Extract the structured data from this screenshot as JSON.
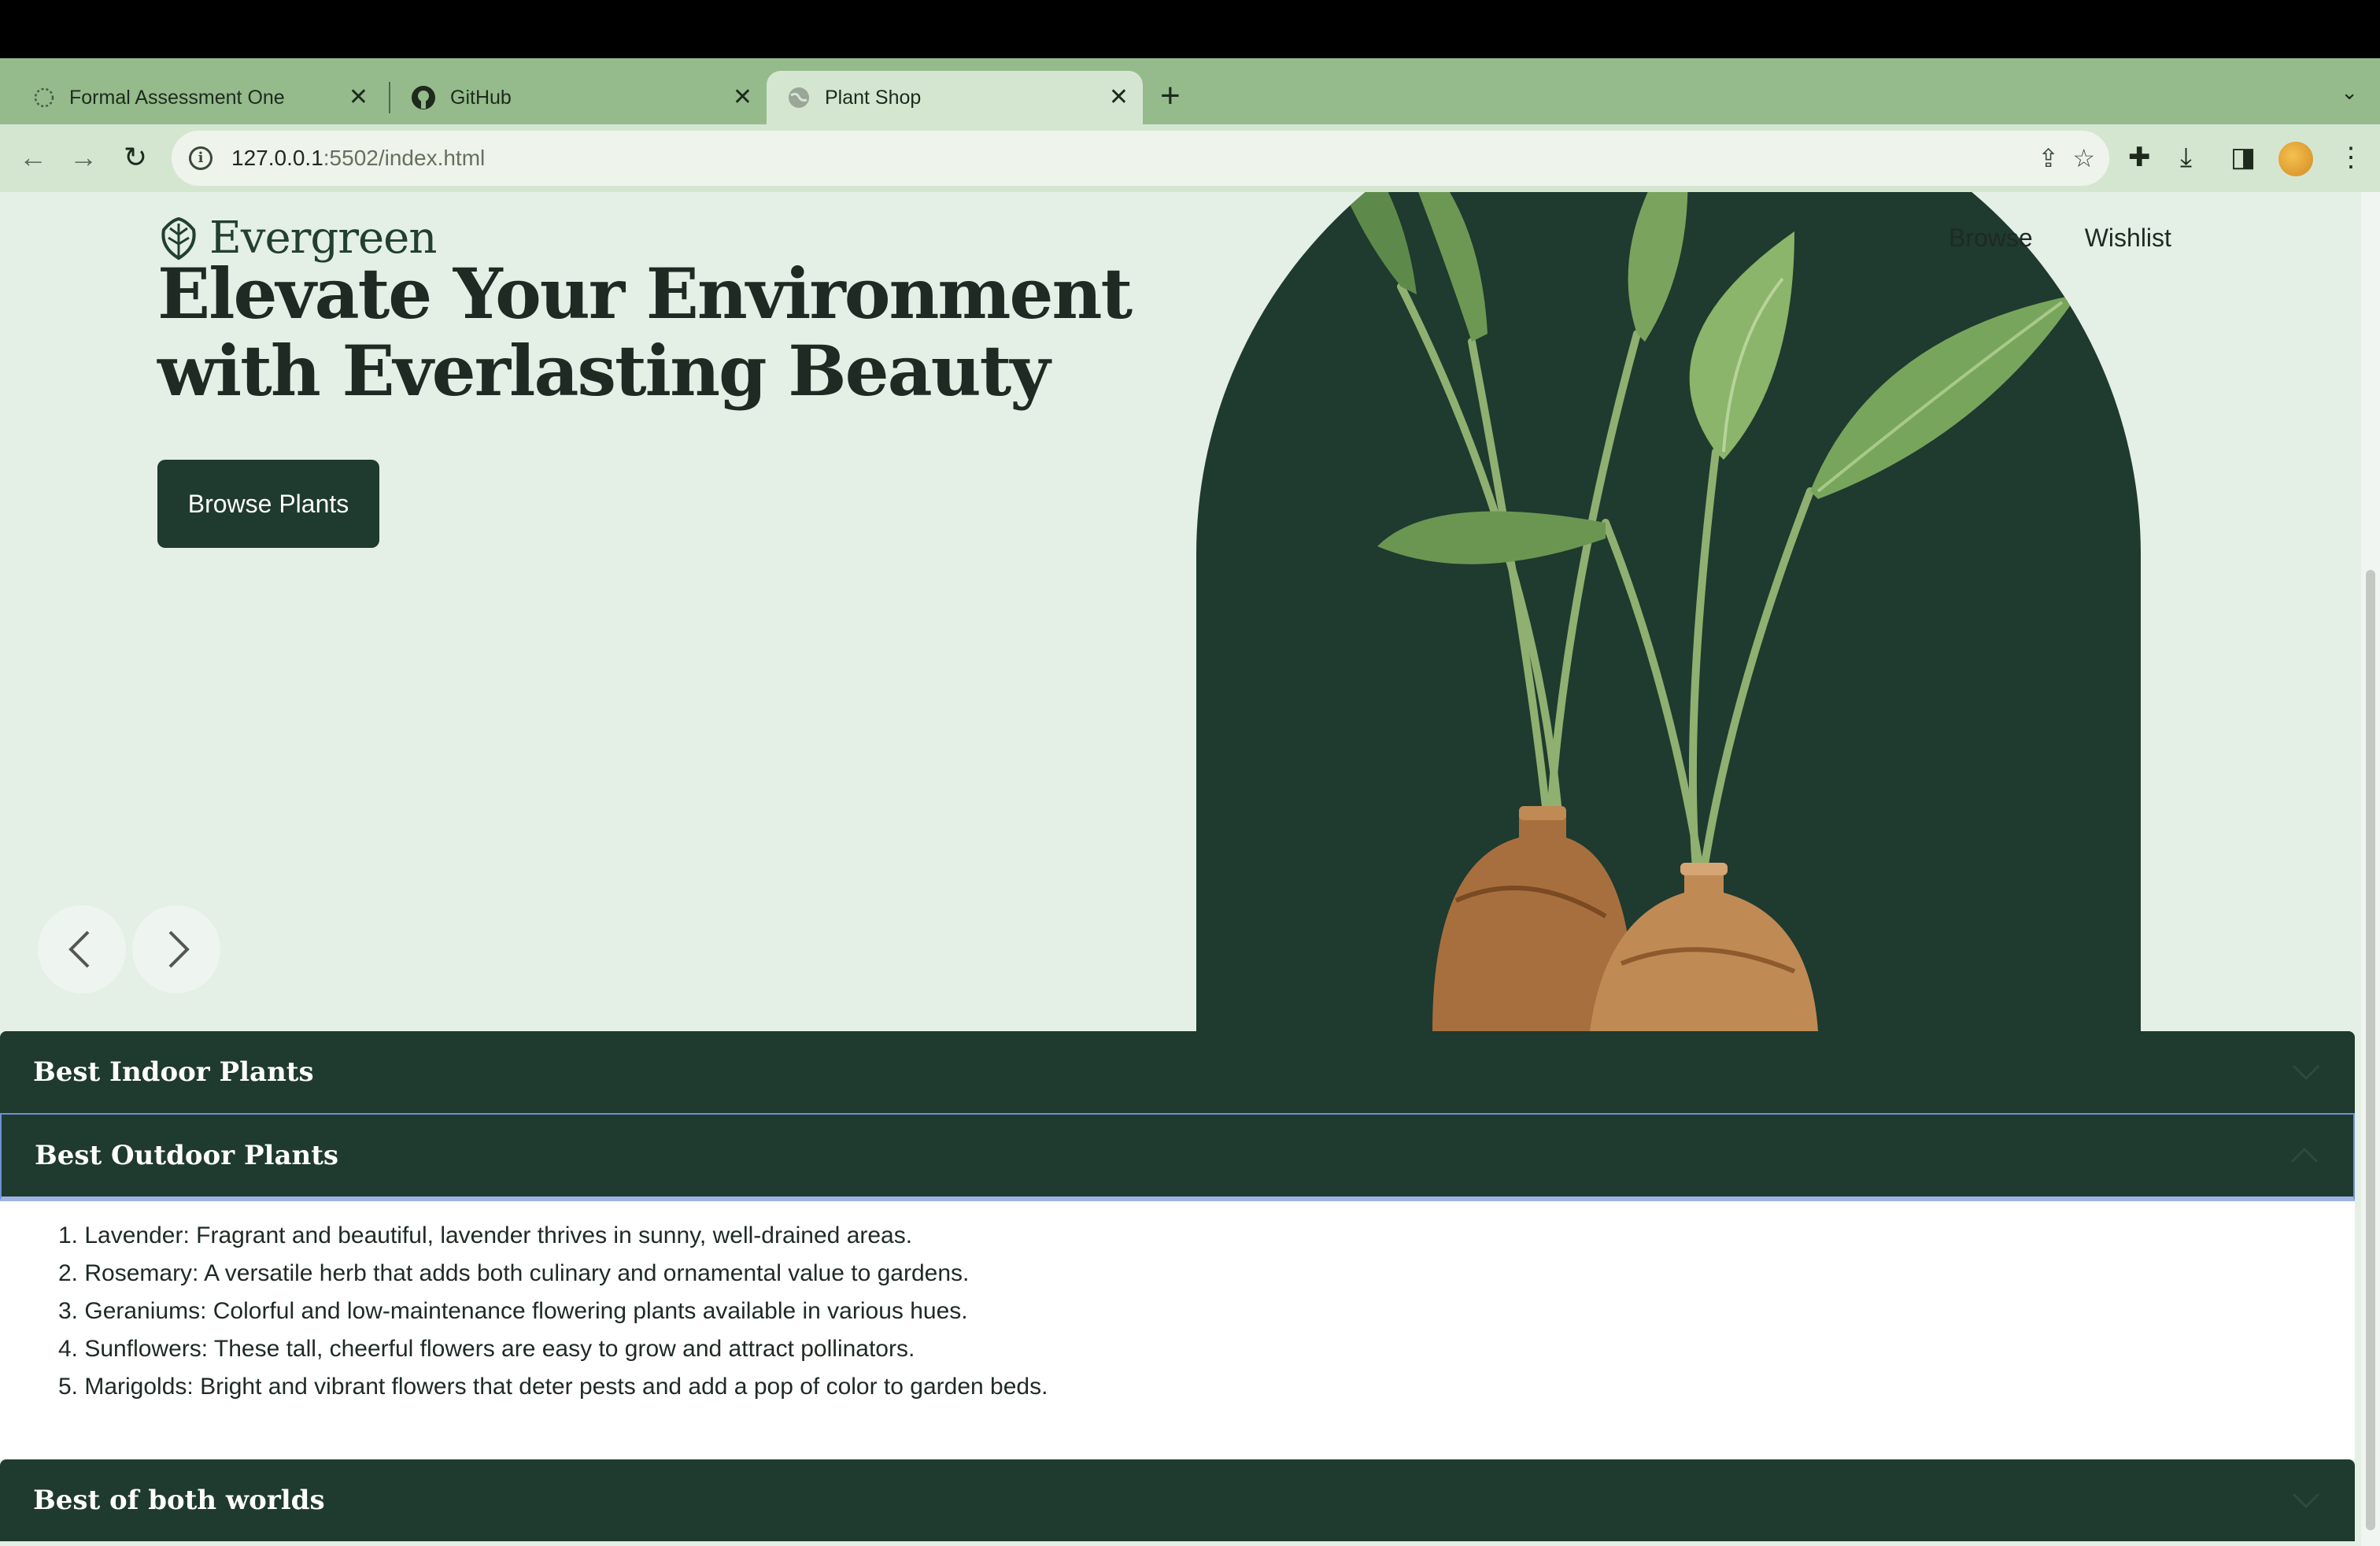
{
  "browser": {
    "tabs": [
      {
        "label": "Formal Assessment One",
        "icon": "loading-icon"
      },
      {
        "label": "GitHub",
        "icon": "github-icon"
      },
      {
        "label": "Plant Shop",
        "icon": "globe-icon",
        "active": true
      }
    ],
    "url_host": "127.0.0.1",
    "url_path": ":5502/index.html"
  },
  "site": {
    "brand": "Evergreen",
    "nav": [
      "Browse",
      "Wishlist"
    ],
    "headline": "Elevate Your Environment with Everlasting Beauty",
    "cta_label": "Browse Plants"
  },
  "accordion": {
    "sections": [
      {
        "title": "Best Indoor Plants",
        "open": false
      },
      {
        "title": "Best Outdoor Plants",
        "open": true
      },
      {
        "title": "Best of both worlds",
        "open": false
      }
    ],
    "outdoor_items": [
      "1. Lavender: Fragrant and beautiful, lavender thrives in sunny, well-drained areas.",
      "2. Rosemary: A versatile herb that adds both culinary and ornamental value to gardens.",
      "3. Geraniums: Colorful and low-maintenance flowering plants available in various hues.",
      "4. Sunflowers: These tall, cheerful flowers are easy to grow and attract pollinators.",
      "5. Marigolds: Bright and vibrant flowers that deter pests and add a pop of color to garden beds."
    ]
  },
  "colors": {
    "brand_dark": "#1f3a2e",
    "page_bg": "#e4efe6",
    "tab_strip": "#95bb8d"
  }
}
